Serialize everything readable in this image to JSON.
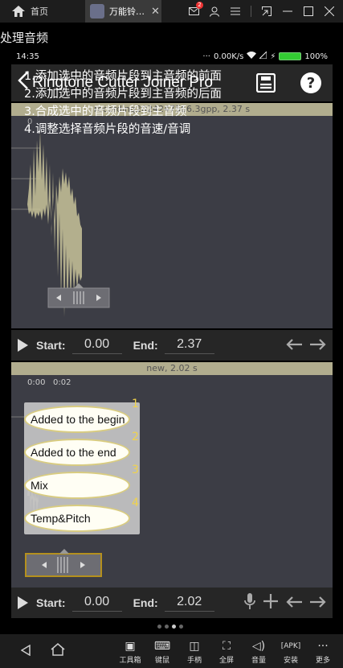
{
  "emulator": {
    "home_label": "首页",
    "tab_label": "万能铃…",
    "tab_close": "✕",
    "badge": "2",
    "window_icons": [
      "mail-icon",
      "user-icon",
      "menu-icon",
      "shrink-icon",
      "minimize-icon",
      "maximize-icon",
      "close-icon"
    ],
    "bottom_tools": [
      {
        "icon": "toolbox-icon",
        "label": "工具箱"
      },
      {
        "icon": "keyboard-icon",
        "label": "键鼠"
      },
      {
        "icon": "gamepad-icon",
        "label": "手柄"
      },
      {
        "icon": "fullscreen-icon",
        "label": "全屏"
      },
      {
        "icon": "volume-icon",
        "label": "音量"
      },
      {
        "icon": "apk-icon",
        "label": "安装"
      },
      {
        "icon": "more-icon",
        "label": "更多"
      }
    ]
  },
  "page_title": "处理音频",
  "statusbar": {
    "time": "14:35",
    "speed": "0.00K/s",
    "battery": "100%"
  },
  "app": {
    "title": "Ringtone Cutter Joiner Pro"
  },
  "track1": {
    "filename": "recording2024247566.3gpp, 2.37 s",
    "start_label": "Start:",
    "start_value": "0.00",
    "end_label": "End:",
    "end_value": "2.37",
    "tick": "0"
  },
  "track2": {
    "filename": "new, 2.02 s",
    "start_label": "Start:",
    "start_value": "0.00",
    "end_label": "End:",
    "end_value": "2.02",
    "ticks": [
      "0.00",
      "0:02"
    ]
  },
  "instructions": [
    "1.添加选中的音频片段到主音频的前面",
    "2.添加选中的音频片段到主音频的后面",
    "3.合成选中的音频片段到主音频",
    "4.调整选择音频片段的音速/音调"
  ],
  "menu": [
    {
      "num": "1",
      "label": "Added to the begin"
    },
    {
      "num": "2",
      "label": "Added to the end"
    },
    {
      "num": "3",
      "label": "Mix"
    },
    {
      "num": "4",
      "label": "Temp&Pitch"
    }
  ],
  "colors": {
    "track_bg": "#3c3d45",
    "header": "#b1ad8e",
    "waveform": "#c8c39a",
    "accent": "#f1d34a"
  }
}
